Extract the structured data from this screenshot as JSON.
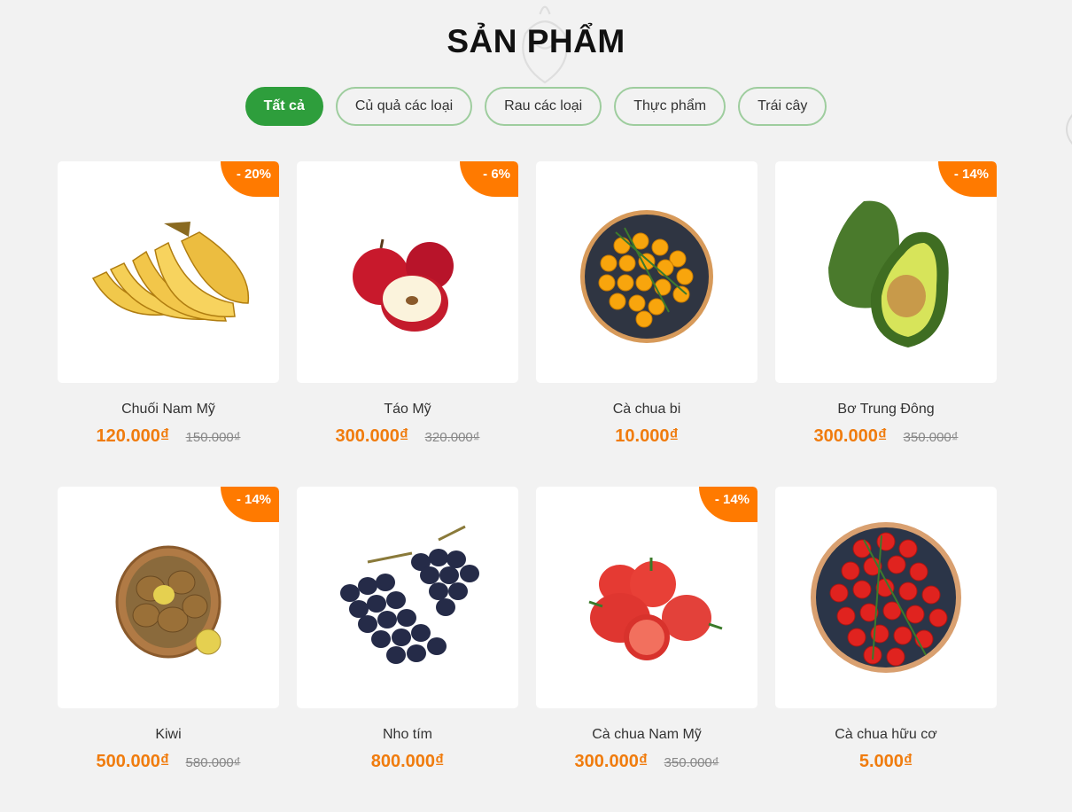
{
  "section": {
    "title": "SẢN PHẨM"
  },
  "tabs": [
    {
      "label": "Tất cả",
      "active": true
    },
    {
      "label": "Củ quả các loại",
      "active": false
    },
    {
      "label": "Rau các loại",
      "active": false
    },
    {
      "label": "Thực phẩm",
      "active": false
    },
    {
      "label": "Trái cây",
      "active": false
    }
  ],
  "colors": {
    "accent": "#2e9e3c",
    "price": "#f07c0e",
    "badge": "#ff7a00",
    "background": "#f2f2f2"
  },
  "products": [
    {
      "name": "Chuối Nam Mỹ",
      "price": "120.000₫",
      "old_price": "150.000₫",
      "discount": "- 20%",
      "image": "banana-image"
    },
    {
      "name": "Táo Mỹ",
      "price": "300.000₫",
      "old_price": "320.000₫",
      "discount": "- 6%",
      "image": "apple-image"
    },
    {
      "name": "Cà chua bi",
      "price": "10.000₫",
      "old_price": "",
      "discount": "",
      "image": "yellow-cherry-tomato-image"
    },
    {
      "name": "Bơ Trung Đông",
      "price": "300.000₫",
      "old_price": "350.000₫",
      "discount": "- 14%",
      "image": "avocado-image"
    },
    {
      "name": "Kiwi",
      "price": "500.000₫",
      "old_price": "580.000₫",
      "discount": "- 14%",
      "image": "kiwi-basket-image"
    },
    {
      "name": "Nho tím",
      "price": "800.000₫",
      "old_price": "",
      "discount": "",
      "image": "purple-grape-image"
    },
    {
      "name": "Cà chua Nam Mỹ",
      "price": "300.000₫",
      "old_price": "350.000₫",
      "discount": "- 14%",
      "image": "red-tomato-image"
    },
    {
      "name": "Cà chua hữu cơ",
      "price": "5.000₫",
      "old_price": "",
      "discount": "",
      "image": "organic-cherry-tomato-image"
    }
  ]
}
